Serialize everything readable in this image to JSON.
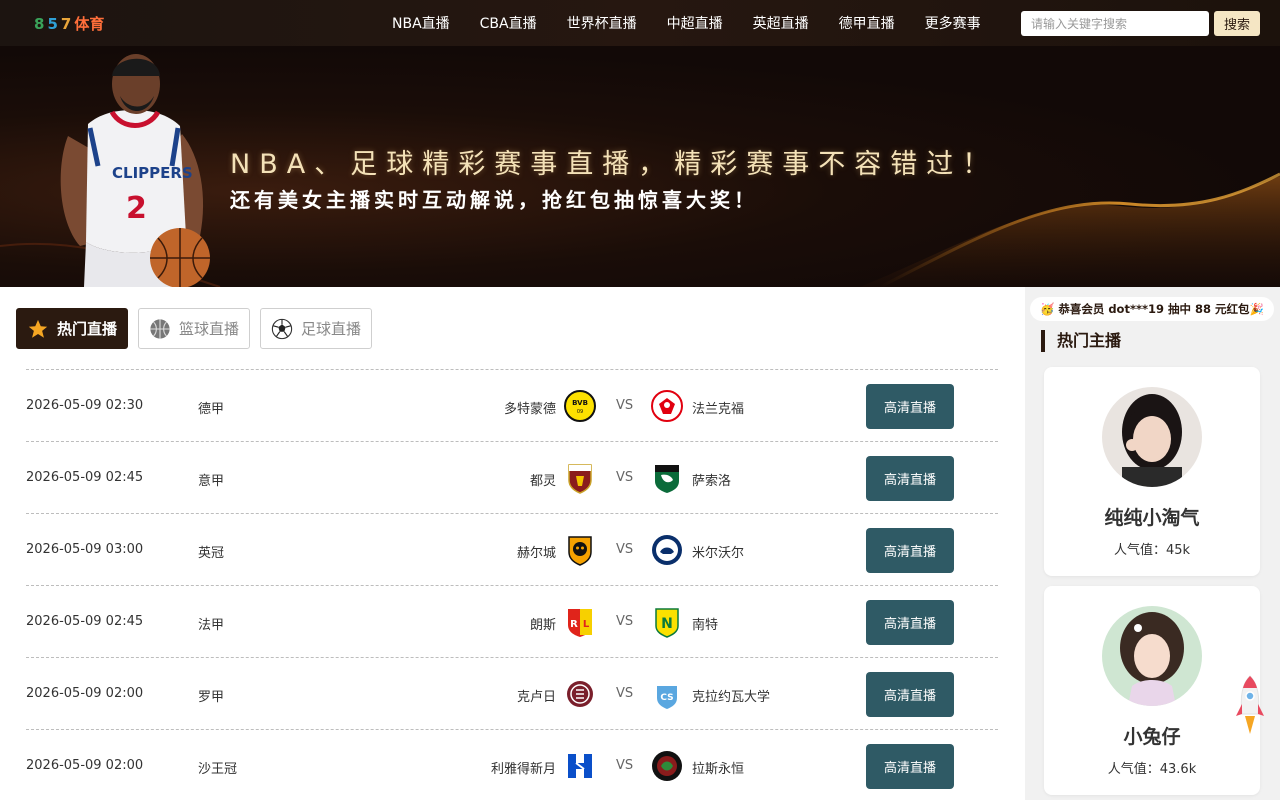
{
  "header": {
    "logo_digits": [
      "8",
      "5",
      "7"
    ],
    "logo_text": "体育",
    "nav": [
      "NBA直播",
      "CBA直播",
      "世界杯直播",
      "中超直播",
      "英超直播",
      "德甲直播",
      "更多赛事"
    ],
    "search_placeholder": "请输入关键字搜索",
    "search_button": "搜索"
  },
  "banner": {
    "title": "NBA、足球精彩赛事直播，精彩赛事不容错过！",
    "subtitle": "还有美女主播实时互动解说，抢红包抽惊喜大奖！",
    "jersey_team": "CLIPPERS",
    "jersey_number": "2"
  },
  "tabs": [
    {
      "label": "热门直播",
      "icon": "star-icon",
      "active": true
    },
    {
      "label": "篮球直播",
      "icon": "basketball-icon",
      "active": false
    },
    {
      "label": "足球直播",
      "icon": "soccer-ball-icon",
      "active": false
    }
  ],
  "matches": [
    {
      "time": "2026-05-09 02:30",
      "league": "德甲",
      "home": "多特蒙德",
      "away": "法兰克福",
      "vs": "VS",
      "button": "高清直播",
      "home_icon": "dortmund-logo-icon",
      "away_icon": "frankfurt-logo-icon"
    },
    {
      "time": "2026-05-09 02:45",
      "league": "意甲",
      "home": "都灵",
      "away": "萨索洛",
      "vs": "VS",
      "button": "高清直播",
      "home_icon": "torino-logo-icon",
      "away_icon": "sassuolo-logo-icon"
    },
    {
      "time": "2026-05-09 03:00",
      "league": "英冠",
      "home": "赫尔城",
      "away": "米尔沃尔",
      "vs": "VS",
      "button": "高清直播",
      "home_icon": "hull-city-logo-icon",
      "away_icon": "millwall-logo-icon"
    },
    {
      "time": "2026-05-09 02:45",
      "league": "法甲",
      "home": "朗斯",
      "away": "南特",
      "vs": "VS",
      "button": "高清直播",
      "home_icon": "lens-logo-icon",
      "away_icon": "nantes-logo-icon"
    },
    {
      "time": "2026-05-09 02:00",
      "league": "罗甲",
      "home": "克卢日",
      "away": "克拉约瓦大学",
      "vs": "VS",
      "button": "高清直播",
      "home_icon": "cfr-cluj-logo-icon",
      "away_icon": "craiova-logo-icon"
    },
    {
      "time": "2026-05-09 02:00",
      "league": "沙王冠",
      "home": "利雅得新月",
      "away": "拉斯永恒",
      "vs": "VS",
      "button": "高清直播",
      "home_icon": "al-hilal-logo-icon",
      "away_icon": "al-raed-logo-icon"
    }
  ],
  "sidebar": {
    "notice": "🥳 恭喜会员 dot***19 抽中 88 元红包🎉",
    "title": "热门主播",
    "anchors": [
      {
        "name": "纯纯小淘气",
        "popularity": "人气值：45k"
      },
      {
        "name": "小兔仔",
        "popularity": "人气值：43.6k"
      }
    ]
  },
  "colors": {
    "header_bg": "#1c1410",
    "active_tab": "#2b1a10",
    "live_button": "#2f5a65",
    "banner_gold": "#f4e2b8"
  }
}
